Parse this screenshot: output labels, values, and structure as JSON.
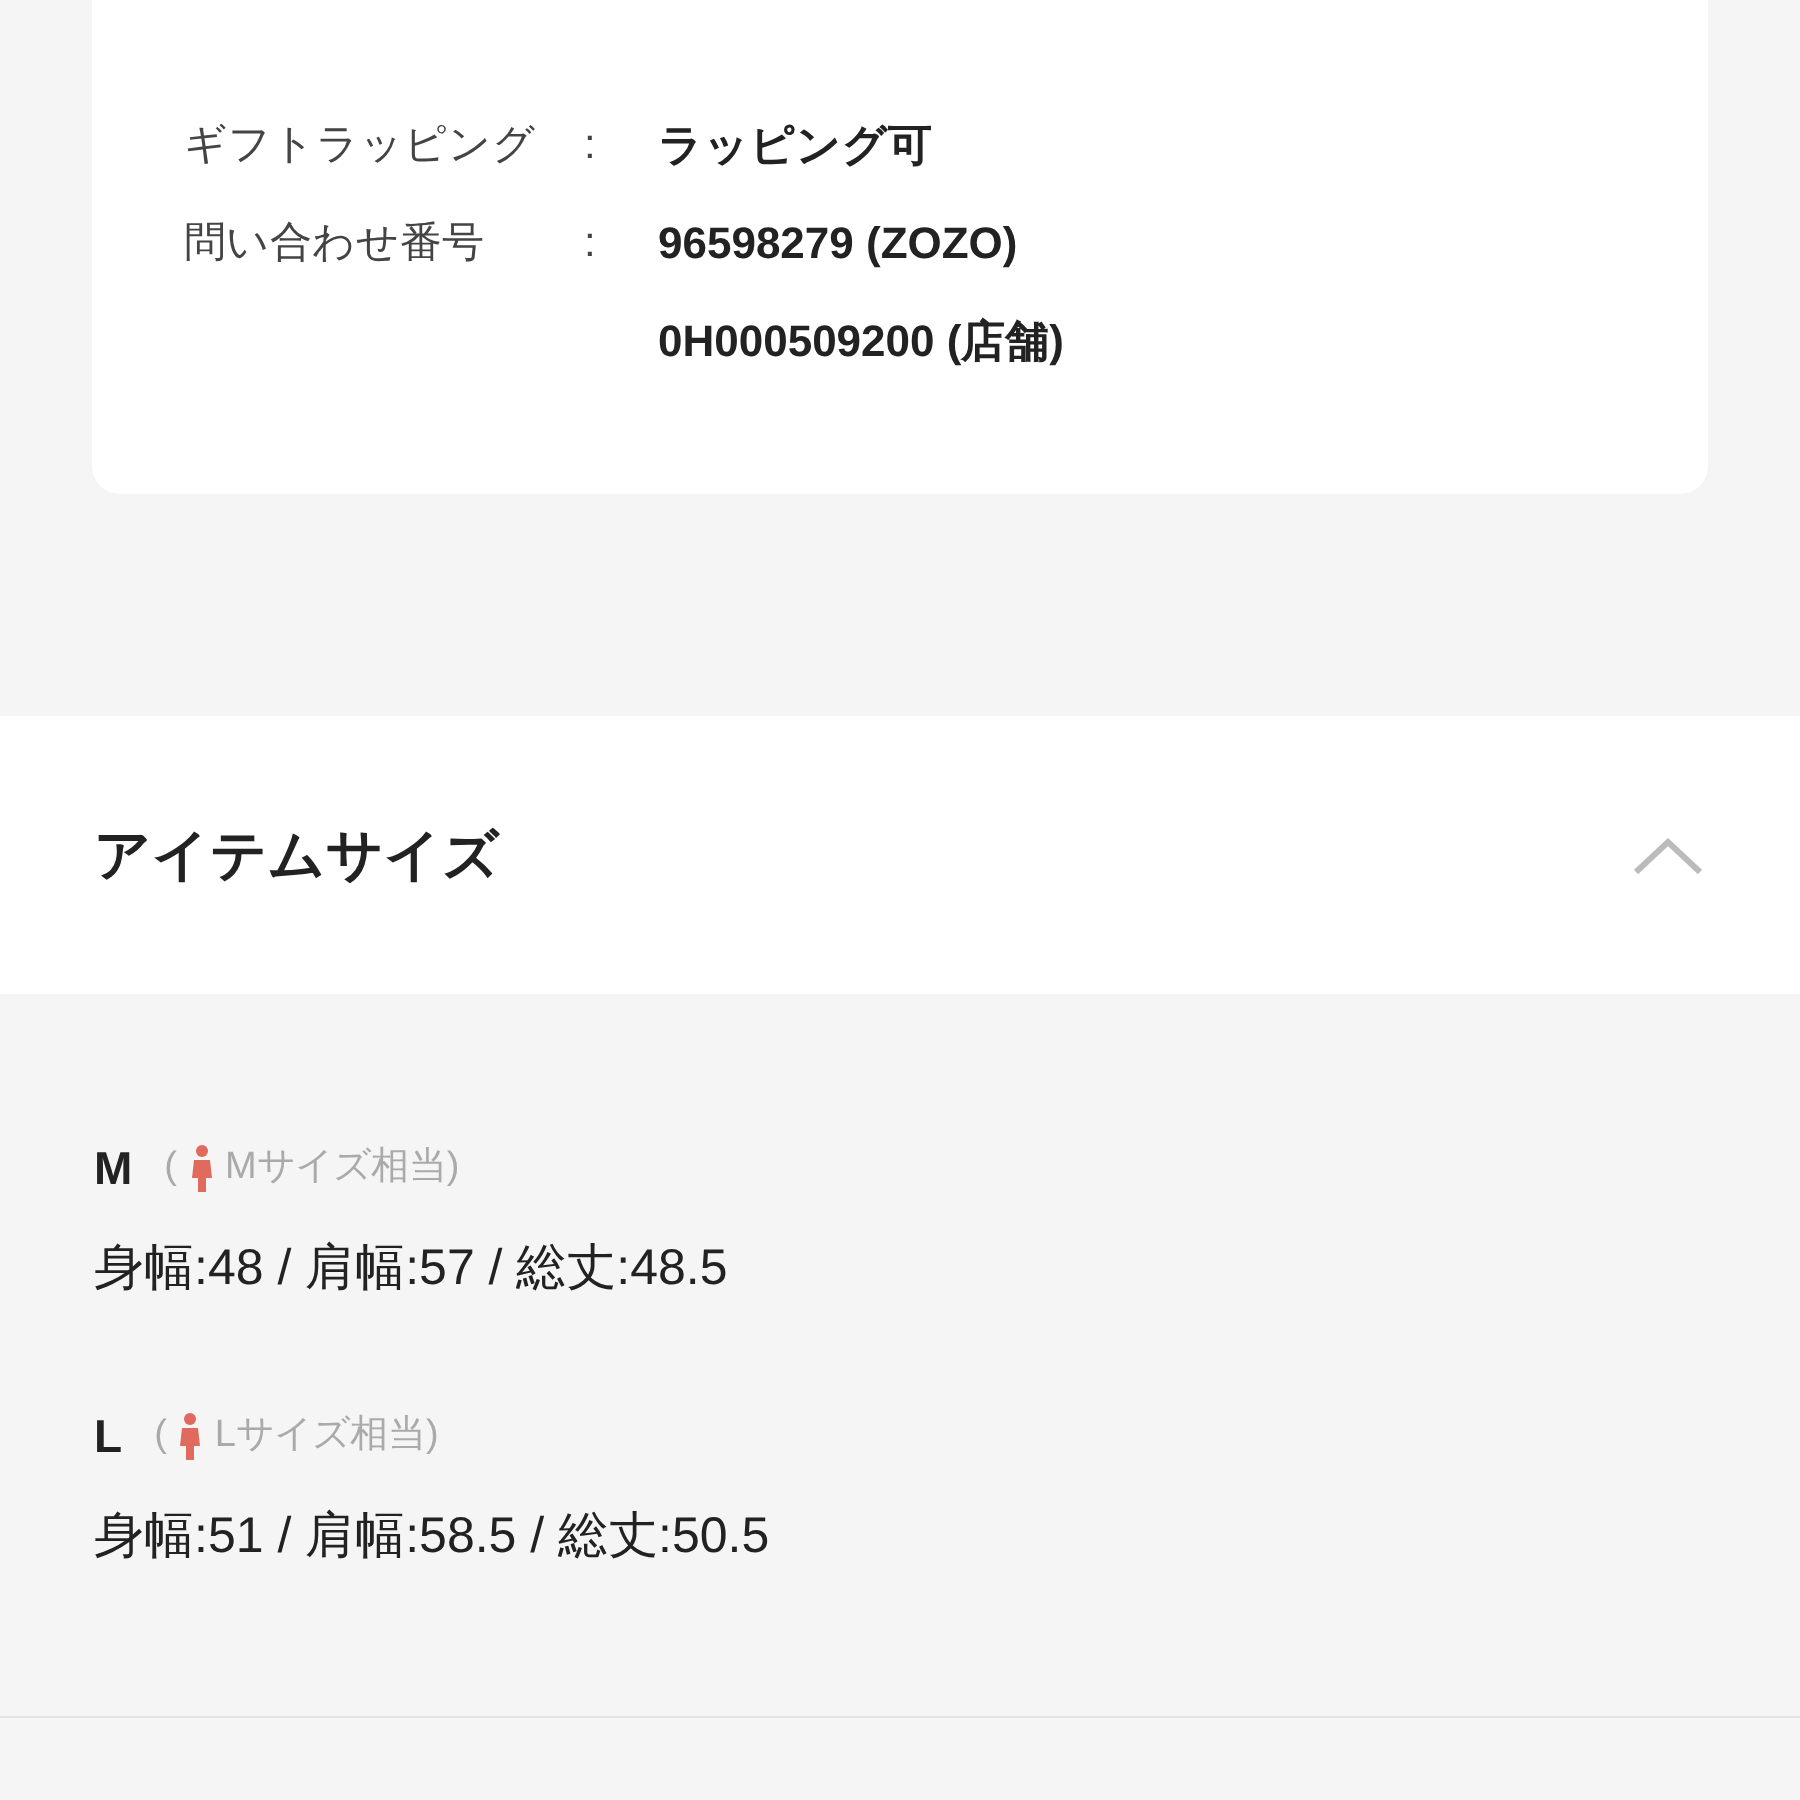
{
  "details": [
    {
      "label": "ギフトラッピング",
      "separator": ":",
      "values": [
        "ラッピング可"
      ]
    },
    {
      "label": "問い合わせ番号",
      "separator": ":",
      "values": [
        "96598279 (ZOZO)",
        "0H000509200 (店舗)"
      ]
    }
  ],
  "item_size": {
    "title": "アイテムサイズ",
    "expanded": true,
    "sizes": [
      {
        "size": "M",
        "open_paren": "(",
        "equivalent": "Mサイズ相当)",
        "measurements": "身幅:48 / 肩幅:57 / 総丈:48.5"
      },
      {
        "size": "L",
        "open_paren": "(",
        "equivalent": "Lサイズ相当)",
        "measurements": "身幅:51 / 肩幅:58.5 / 総丈:50.5"
      }
    ]
  }
}
